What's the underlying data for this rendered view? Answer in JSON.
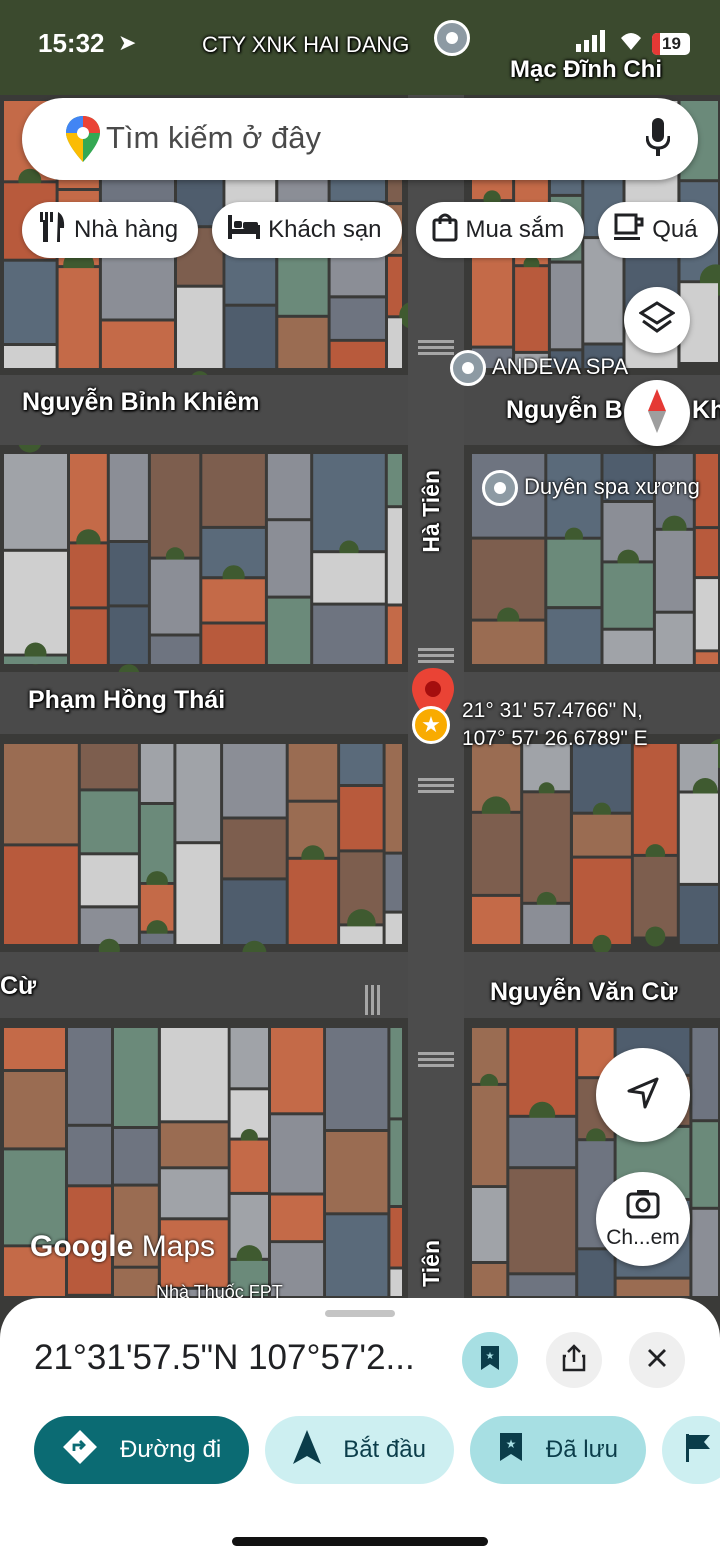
{
  "status": {
    "time": "15:32",
    "battery": "19",
    "top_poi": "CTY XNK HAI DANG"
  },
  "search": {
    "placeholder": "Tìm kiếm ở đây"
  },
  "chips": [
    {
      "label": "Nhà hàng",
      "icon": "fork-knife-icon"
    },
    {
      "label": "Khách sạn",
      "icon": "bed-icon"
    },
    {
      "label": "Mua sắm",
      "icon": "shopping-bag-icon"
    },
    {
      "label": "Quá",
      "icon": "coffee-cup-icon"
    }
  ],
  "map": {
    "streets": [
      "Mạc Đĩnh Chi",
      "Nguyễn Bỉnh Khiêm",
      "Nguyễn B",
      "Khi",
      "Hà Tiên",
      "Phạm Hồng Thái",
      "Nguyễn Văn Cừ",
      "Cừ",
      "Tiên"
    ],
    "pois": [
      "ANDEVA SPA",
      "Duyên spa xương",
      "Nhà Thuốc FPT"
    ],
    "pin_label_line1": "21° 31' 57.4766\" N,",
    "pin_label_line2": "107° 57' 26.6789\" E",
    "watermark_google": "Google",
    "watermark_maps": "Maps",
    "lens_label": "Ch...em"
  },
  "sheet": {
    "coords": "21°31'57.5\"N 107°57'2...",
    "actions": [
      {
        "label": "Đường đi",
        "icon": "directions-icon"
      },
      {
        "label": "Bắt đầu",
        "icon": "navigation-arrow-icon"
      },
      {
        "label": "Đã lưu",
        "icon": "bookmark-icon"
      }
    ]
  },
  "colors": {
    "primary": "#0b6b73",
    "secondary_bg": "#cdeff1",
    "saved_bg": "#a7dfe3",
    "pin_red": "#ea4335",
    "compass_red": "#e53935"
  }
}
